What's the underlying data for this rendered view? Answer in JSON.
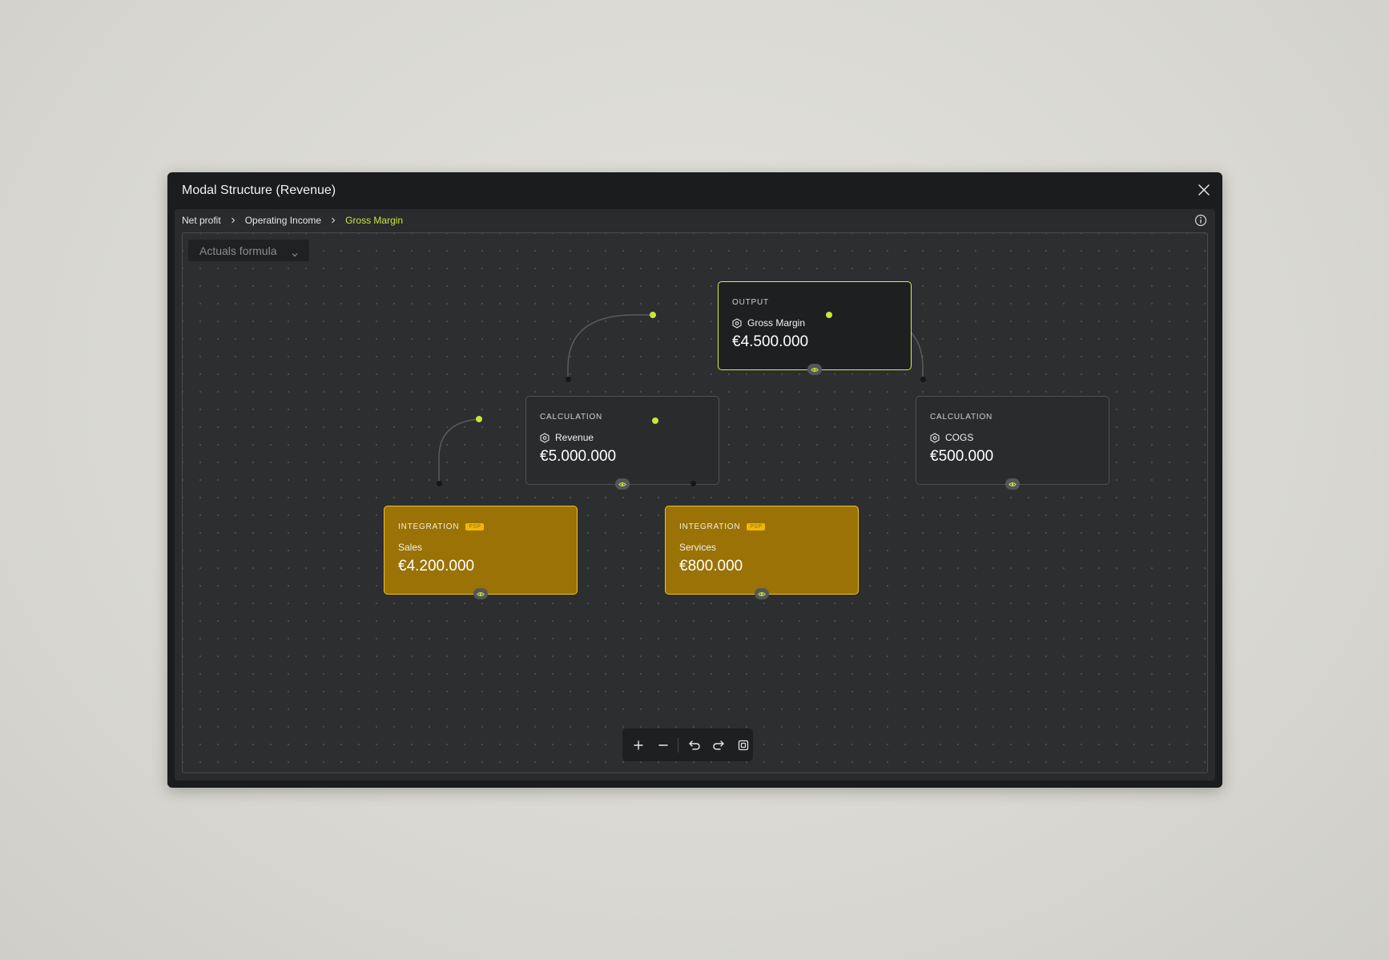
{
  "modal": {
    "title": "Modal Structure (Revenue)"
  },
  "breadcrumb": [
    {
      "label": "Net profit"
    },
    {
      "label": "Operating Income"
    },
    {
      "label": "Gross Margin"
    }
  ],
  "formula_dropdown": {
    "selected": "Actuals formula"
  },
  "nodes": {
    "output": {
      "type": "OUTPUT",
      "name": "Gross Margin",
      "value": "€4.500.000"
    },
    "revenue": {
      "type": "CALCULATION",
      "name": "Revenue",
      "value": "€5.000.000"
    },
    "cogs": {
      "type": "CALCULATION",
      "name": "COGS",
      "value": "€500.000"
    },
    "sales": {
      "type": "INTEGRATION",
      "badge": "PSP",
      "name": "Sales",
      "value": "€4.200.000"
    },
    "services": {
      "type": "INTEGRATION",
      "badge": "PSP",
      "name": "Services",
      "value": "€800.000"
    }
  },
  "colors": {
    "accent": "#c8e63a",
    "integration_fill": "#9a7206",
    "integration_border": "#f0c21a",
    "modal_bg": "#1b1c1e"
  },
  "toolbar": {
    "icons": [
      "plus-icon",
      "minus-icon",
      "undo-icon",
      "redo-icon",
      "fit-view-icon"
    ]
  }
}
